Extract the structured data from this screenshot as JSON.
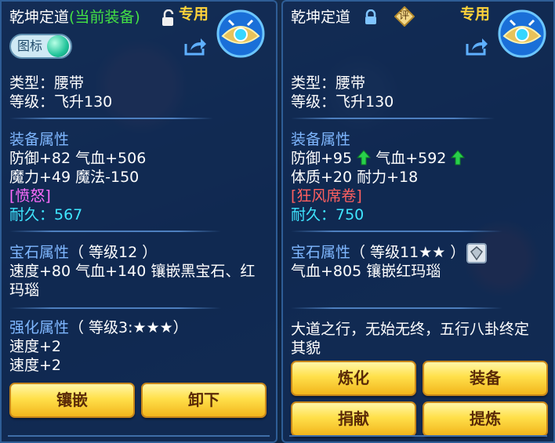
{
  "left": {
    "title": "乾坤定道",
    "current_tag": "(当前装备)",
    "exclusive": "专用",
    "icon_toggle_label": "图标",
    "type": "类型：腰带",
    "level": "等级：飞升130",
    "equip_section": "装备属性",
    "attr1": "防御+82 气血+506",
    "attr2": "魔力+49 魔法-150",
    "special": "[愤怒]",
    "durability": "耐久：567",
    "gem_section": "宝石属性",
    "gem_level": "（ 等级12 ）",
    "gem_line1": "速度+80 气血+140 镶嵌黑宝石、红",
    "gem_line2": "玛瑙",
    "enhance_section": "强化属性",
    "enhance_level": "（ 等级3:★★★）",
    "enhance_line1": "速度+2",
    "enhance_line2": "速度+2",
    "btn_inlay": "镶嵌",
    "btn_unequip": "卸下"
  },
  "right": {
    "title": "乾坤定道",
    "rate_badge": "评",
    "exclusive": "专用",
    "type": "类型：腰带",
    "level": "等级：飞升130",
    "equip_section": "装备属性",
    "attr1a": "防御+95",
    "attr1b": "气血+592",
    "attr2": "体质+20 耐力+18",
    "special": "[狂风席卷]",
    "durability": "耐久：750",
    "gem_section": "宝石属性",
    "gem_level": "（ 等级11★★ ）",
    "gem_line1": "气血+805 镶嵌红玛瑙",
    "desc_line1": "大道之行，无始无终，五行八卦终定",
    "desc_line2": "其貌",
    "btn_refine": "炼化",
    "btn_equip": "装备",
    "btn_donate": "捐献",
    "btn_extract": "提炼"
  },
  "colors": {
    "panel_bg": "#122c56",
    "section_blue": "#7fb7ff",
    "durability_cyan": "#3fe6ff",
    "special_pink": "#ff6cff",
    "special_red": "#ff6060",
    "current_green": "#44e244",
    "exclusive_gold": "#ffd23a",
    "button_gold": "#ffe04a"
  }
}
